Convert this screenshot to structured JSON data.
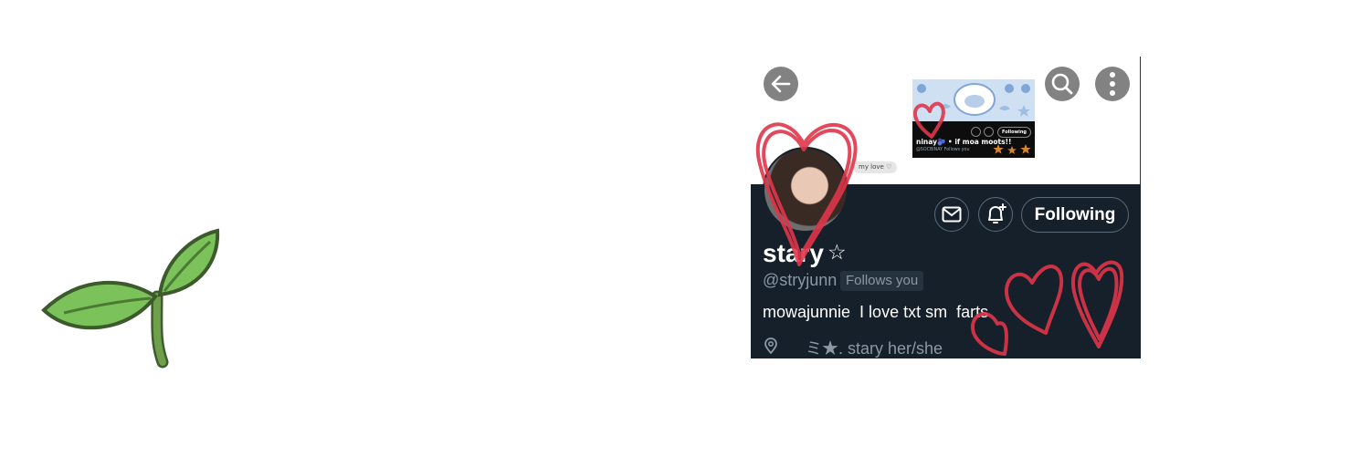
{
  "profile": {
    "display_name": "stary",
    "name_star": "☆",
    "handle": "@stryjunn",
    "follows_you_label": "Follows you",
    "bio": "mowajunnie  I love txt sm  farts",
    "location": "ミ★. stary her/she",
    "following_label": "Following"
  },
  "tag_bubble": "my love ♡",
  "mini_screenshot": {
    "name": "ninay🫐 • if moa moots!!",
    "handle": "@SOCBINAY  Follows you",
    "following_label": "Following"
  },
  "icons": {
    "back": "arrow-left-icon",
    "search": "search-icon",
    "more": "more-vertical-icon",
    "message": "mail-icon",
    "notify": "bell-plus-icon",
    "location": "location-pin-icon",
    "sprout": "sprout-icon"
  },
  "colors": {
    "dark_background": "#15202b",
    "secondary_text": "#8b98a5",
    "doodle_red": "#e0354a",
    "header_button": "#828282"
  }
}
